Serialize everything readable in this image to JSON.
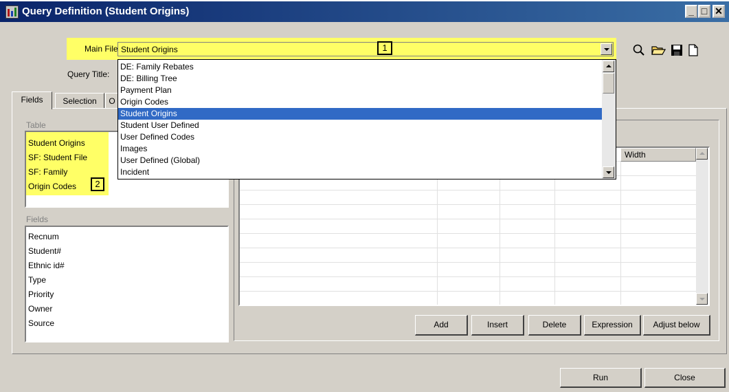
{
  "window": {
    "title": "Query Definition (Student Origins)",
    "minimize_glyph": "_",
    "maximize_glyph": "□",
    "close_glyph": "✕"
  },
  "form": {
    "main_file_label": "Main File:",
    "main_file_value": "Student Origins",
    "query_title_label": "Query Title:",
    "annotation_1": "1",
    "annotation_2": "2"
  },
  "dropdown": {
    "items": [
      "DE: Family Rebates",
      "DE: Billing Tree",
      "Payment Plan",
      "Origin Codes",
      "Student Origins",
      "Student User Defined",
      "User Defined Codes",
      "Images",
      "User Defined (Global)",
      "Incident"
    ],
    "selected_index": 4
  },
  "tabs": [
    {
      "label": "Fields"
    },
    {
      "label": "Selection"
    },
    {
      "label": "O"
    }
  ],
  "table_panel": {
    "label": "Table",
    "items": [
      "Student Origins",
      "SF: Student File",
      "SF: Family",
      "Origin Codes"
    ]
  },
  "fields_panel": {
    "label": "Fields",
    "items": [
      "Recnum",
      "Student#",
      "Ethnic id#",
      "Type",
      "Priority",
      "Owner",
      "Source"
    ]
  },
  "grid": {
    "width_header": "Width"
  },
  "buttons": {
    "add": "Add",
    "insert": "Insert",
    "delete": "Delete",
    "expression": "Expression",
    "adjust_below": "Adjust below",
    "run": "Run",
    "close": "Close"
  },
  "colors": {
    "title_bar": "#0a246a",
    "highlight": "#ffff66",
    "selection": "#316ac5",
    "dialog_face": "#d4d0c8"
  },
  "icons": [
    "search-icon",
    "open-folder-icon",
    "save-icon",
    "new-document-icon"
  ]
}
